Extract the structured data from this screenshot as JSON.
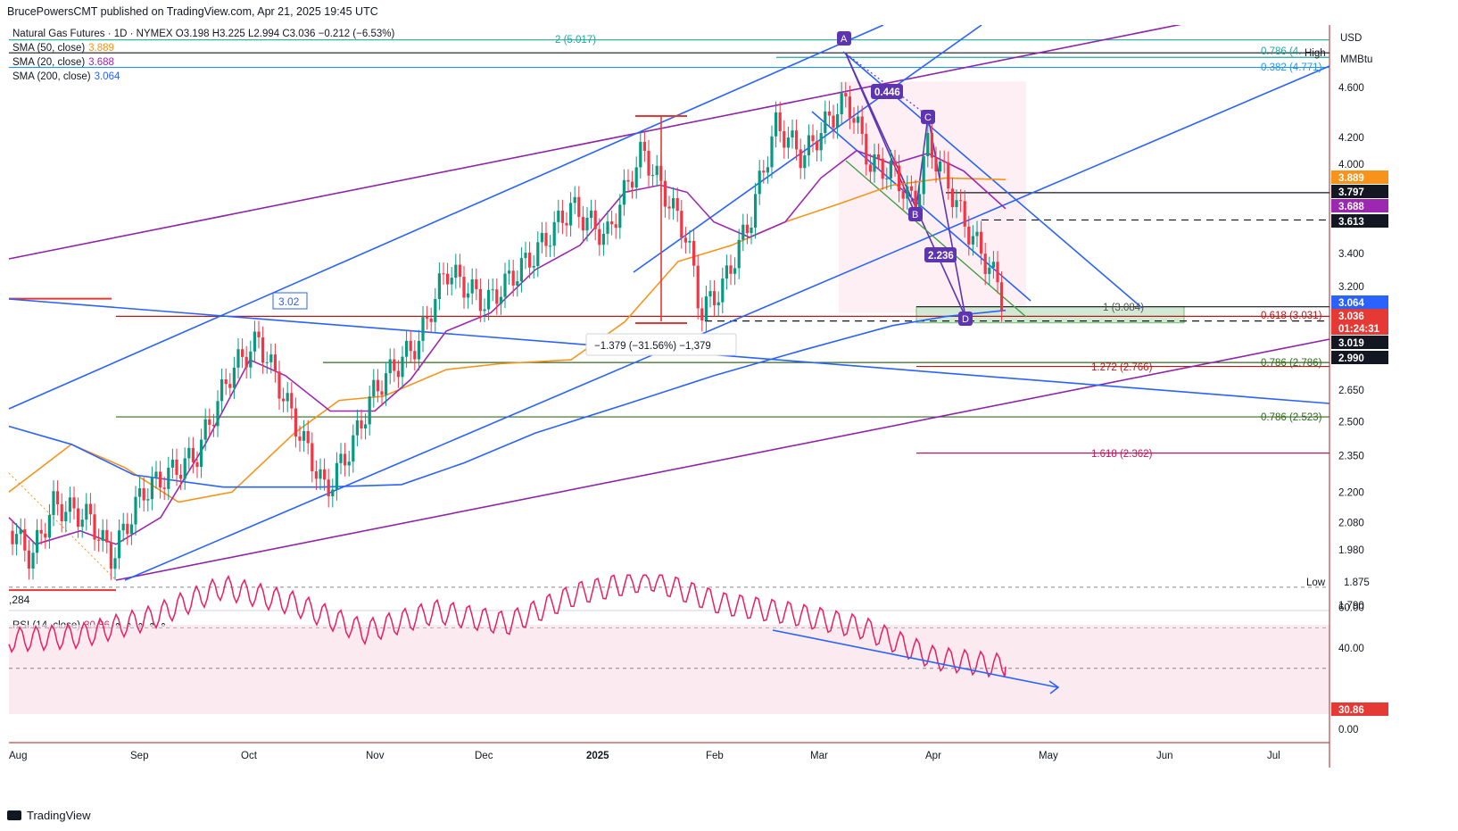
{
  "publisher": "BrucePowersCMT published on TradingView.com, Apr 21, 2025 19:45 UTC",
  "symbol_line": "Natural Gas Futures · 1D · NYMEX  O3.198  H3.225  L2.994  C3.036  −0.212 (−6.53%)",
  "indicators": [
    {
      "label": "SMA (50, close)",
      "value": "3.889",
      "color": "#f7931a"
    },
    {
      "label": "SMA (20, close)",
      "value": "3.688",
      "color": "#9c27b0"
    },
    {
      "label": "SMA (200, close)",
      "value": "3.064",
      "color": "#2962ff"
    }
  ],
  "rsi_label": "RSI (14, close)",
  "rsi_value": "30.86",
  "rsi_dots": "⚬ ⚬ ⚬ ⚬ ⚬",
  "currency": "USD",
  "unit": "MMBtu",
  "footer": "TradingView",
  "price_axis_ticks": [
    "4.600",
    "4.200",
    "4.000",
    "3.400",
    "3.200",
    "2.650",
    "2.500",
    "2.350",
    "2.200",
    "2.080",
    "1.980",
    "1.790"
  ],
  "rsi_axis_ticks": [
    "60.00",
    "40.00",
    "0.00"
  ],
  "time_axis": [
    "Aug",
    "Sep",
    "Oct",
    "Nov",
    "Dec",
    "2025",
    "Feb",
    "Mar",
    "Apr",
    "May",
    "Jun",
    "Jul"
  ],
  "price_labels": [
    {
      "text": "3.889",
      "bg": "#f7931a",
      "color": "#ffffff"
    },
    {
      "text": "3.797",
      "bg": "#131722",
      "color": "#ffffff"
    },
    {
      "text": "3.688",
      "bg": "#9c27b0",
      "color": "#ffffff"
    },
    {
      "text": "3.613",
      "bg": "#131722",
      "color": "#ffffff"
    },
    {
      "text": "3.064",
      "bg": "#2962ff",
      "color": "#ffffff"
    },
    {
      "text": "3.036",
      "bg": "#e53935",
      "color": "#ffffff"
    },
    {
      "text": "01:24:31",
      "bg": "#e53935",
      "color": "#ffffff"
    },
    {
      "text": "3.019",
      "bg": "#131722",
      "color": "#ffffff"
    },
    {
      "text": "2.990",
      "bg": "#131722",
      "color": "#ffffff"
    },
    {
      "text": "30.86",
      "bg": "#e53935",
      "color": "#ffffff"
    }
  ],
  "high_label": "High",
  "low_label": "Low",
  "low_value": "1.875",
  "fib_labels": [
    {
      "text": "2 (5.017)",
      "color": "#26a69a"
    },
    {
      "text": "0.786 (4.",
      "color": "#26a69a"
    },
    {
      "text": "0.382 (4.771)",
      "color": "#2196f3"
    },
    {
      "text": "1 (3.084)",
      "color": "#555555"
    },
    {
      "text": "0.618 (3.031)",
      "color": "#b71c1c"
    },
    {
      "text": "0.786 (2.786)",
      "color": "#33691e"
    },
    {
      "text": "1.272 (2.766)",
      "color": "#b71c1c"
    },
    {
      "text": "0.786 (2.523)",
      "color": "#33691e"
    },
    {
      "text": "1.618 (2.362)",
      "color": "#c2185b"
    }
  ],
  "harmonic_points": [
    "A",
    "B",
    "C",
    "D"
  ],
  "harmonic_ratios": [
    "0.446",
    "2.236"
  ],
  "measure_label": "−1.379 (−31.56%) −1,379",
  "box_label": "3.02",
  "left_edge_label": ",284",
  "chart_data": {
    "type": "line",
    "title": "Natural Gas Futures · 1D · NYMEX",
    "x": [
      "Aug",
      "Sep",
      "Oct",
      "Nov",
      "Dec",
      "2025",
      "Feb",
      "Mar",
      "Apr"
    ],
    "series": [
      {
        "name": "Natural Gas Futures",
        "values": [
          2.05,
          2.0,
          2.8,
          2.6,
          3.4,
          4.1,
          3.1,
          4.4,
          3.3
        ]
      },
      {
        "name": "SMA (50, close)",
        "values": [
          2.3,
          2.15,
          2.3,
          2.7,
          2.95,
          3.25,
          3.5,
          3.7,
          3.9
        ]
      },
      {
        "name": "SMA (20, close)",
        "values": [
          2.15,
          2.0,
          2.7,
          2.65,
          3.1,
          3.8,
          3.6,
          4.05,
          3.7
        ]
      },
      {
        "name": "SMA (200, close)",
        "values": [
          2.4,
          2.25,
          2.22,
          2.25,
          2.45,
          2.62,
          2.75,
          2.9,
          3.06
        ]
      }
    ],
    "ylim": [
      1.75,
      5.1
    ],
    "last": 3.036,
    "rsi": {
      "name": "RSI (14, close)",
      "last": 30.86,
      "values": [
        44,
        46,
        55,
        70,
        62,
        48,
        58,
        52,
        67,
        74,
        62,
        57,
        50,
        35,
        31
      ],
      "ylim": [
        0,
        80
      ]
    }
  }
}
